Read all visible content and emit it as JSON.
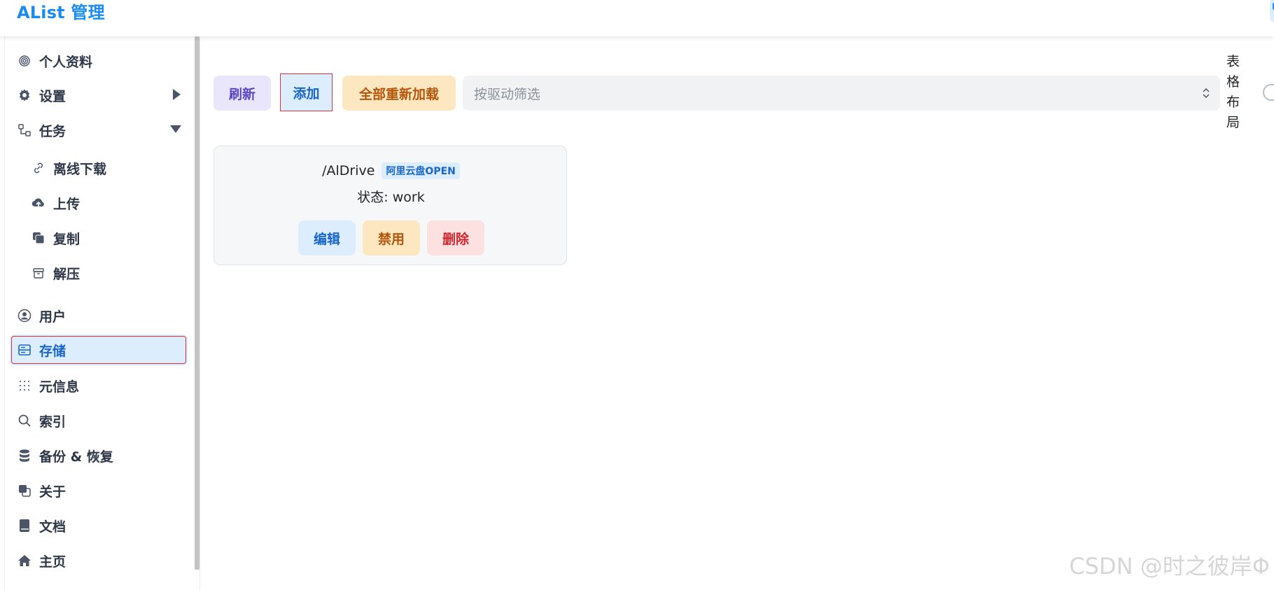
{
  "header": {
    "title": "AList 管理"
  },
  "sidebar": {
    "items": [
      {
        "label": "个人资料",
        "icon": "fingerprint-icon"
      },
      {
        "label": "设置",
        "icon": "gear-icon"
      },
      {
        "label": "任务",
        "icon": "tasks-icon"
      },
      {
        "label": "离线下载",
        "icon": "link-icon"
      },
      {
        "label": "上传",
        "icon": "cloud-upload-icon"
      },
      {
        "label": "复制",
        "icon": "copy-icon"
      },
      {
        "label": "解压",
        "icon": "archive-icon"
      },
      {
        "label": "用户",
        "icon": "user-circle-icon"
      },
      {
        "label": "存储",
        "icon": "storage-icon"
      },
      {
        "label": "元信息",
        "icon": "metadata-icon"
      },
      {
        "label": "索引",
        "icon": "search-icon"
      },
      {
        "label": "备份 & 恢复",
        "icon": "database-icon"
      },
      {
        "label": "关于",
        "icon": "about-icon"
      },
      {
        "label": "文档",
        "icon": "book-icon"
      },
      {
        "label": "主页",
        "icon": "home-icon"
      }
    ],
    "active": "存储"
  },
  "toolbar": {
    "refresh_label": "刷新",
    "add_label": "添加",
    "reload_all_label": "全部重新加载",
    "filter_placeholder": "按驱动筛选",
    "layout_label": "表格布局"
  },
  "storages": [
    {
      "path": "/AlDrive",
      "driver": "阿里云盘OPEN",
      "status": "状态: work",
      "actions": {
        "edit": "编辑",
        "disable": "禁用",
        "delete": "删除"
      }
    }
  ],
  "watermark": "CSDN @时之彼岸Φ",
  "colors": {
    "accent": "#1a8cf0",
    "active_bg": "#dceefe",
    "warning_bg": "#fde7c0",
    "danger_bg": "#fde1e1",
    "purple_bg": "#e9e6fb"
  }
}
